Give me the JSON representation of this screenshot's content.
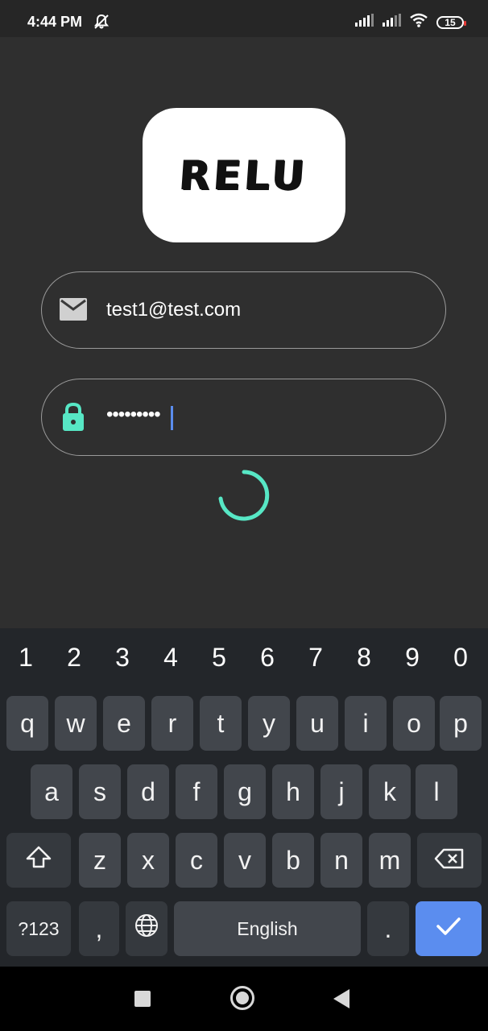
{
  "status_bar": {
    "time": "4:44 PM",
    "battery": "15",
    "icons": [
      "bell-off-icon",
      "signal-icon",
      "signal-icon",
      "wifi-icon",
      "battery-icon"
    ]
  },
  "logo": {
    "text": "RELU"
  },
  "login": {
    "email": {
      "icon": "mail-icon",
      "value": "test1@test.com"
    },
    "password": {
      "icon": "lock-icon",
      "masked_value": "•••••••••"
    },
    "loading": true
  },
  "keyboard": {
    "numbers": [
      "1",
      "2",
      "3",
      "4",
      "5",
      "6",
      "7",
      "8",
      "9",
      "0"
    ],
    "row1": [
      "q",
      "w",
      "e",
      "r",
      "t",
      "y",
      "u",
      "i",
      "o",
      "p"
    ],
    "row2": [
      "a",
      "s",
      "d",
      "f",
      "g",
      "h",
      "j",
      "k",
      "l"
    ],
    "row3": [
      "z",
      "x",
      "c",
      "v",
      "b",
      "n",
      "m"
    ],
    "symbols_label": "?123",
    "comma": ",",
    "space_label": "English",
    "period": "."
  },
  "colors": {
    "accent": "#57e7c5",
    "enter": "#5b8def",
    "background": "#2f2f2f"
  },
  "nav_bar": {
    "icons": [
      "recents-icon",
      "home-icon",
      "back-icon"
    ]
  }
}
